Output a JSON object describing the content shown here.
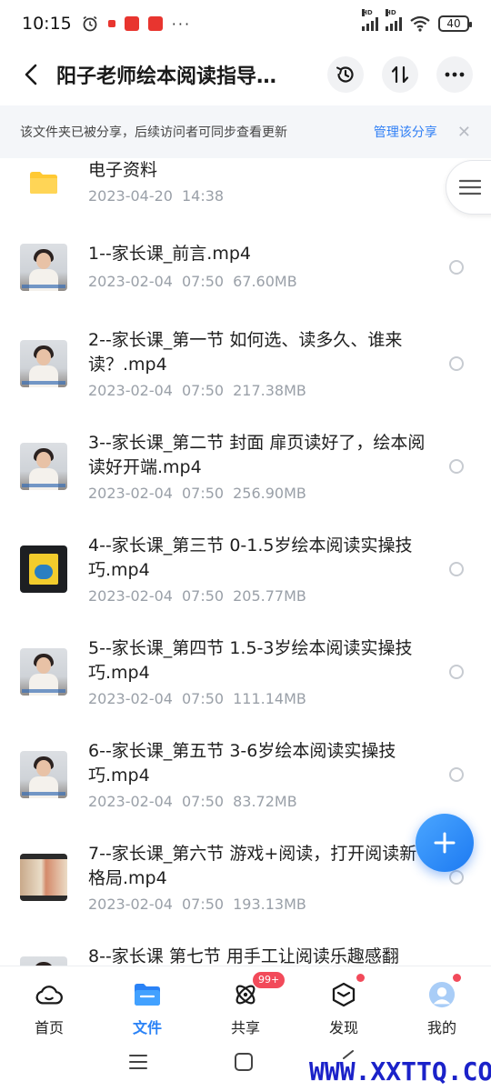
{
  "status_bar": {
    "time": "10:15",
    "battery": "40",
    "signal_label": "HD",
    "more": "···"
  },
  "header": {
    "title": "阳子老师绘本阅读指导…"
  },
  "share_banner": {
    "text": "该文件夹已被分享，后续访问者可同步查看更新",
    "manage_label": "管理该分享",
    "close": "✕"
  },
  "files": [
    {
      "name": "电子资料",
      "date": "2023-04-20",
      "time": "14:38",
      "size": "",
      "kind": "folder"
    },
    {
      "name": "1--家长课_前言.mp4",
      "date": "2023-02-04",
      "time": "07:50",
      "size": "67.60MB",
      "kind": "video-person"
    },
    {
      "name": "2--家长课_第一节 如何选、读多久、谁来读？.mp4",
      "date": "2023-02-04",
      "time": "07:50",
      "size": "217.38MB",
      "kind": "video-person"
    },
    {
      "name": "3--家长课_第二节 封面 扉页读好了，绘本阅读好开端.mp4",
      "date": "2023-02-04",
      "time": "07:50",
      "size": "256.90MB",
      "kind": "video-person"
    },
    {
      "name": "4--家长课_第三节 0-1.5岁绘本阅读实操技巧.mp4",
      "date": "2023-02-04",
      "time": "07:50",
      "size": "205.77MB",
      "kind": "video-book"
    },
    {
      "name": "5--家长课_第四节 1.5-3岁绘本阅读实操技巧.mp4",
      "date": "2023-02-04",
      "time": "07:50",
      "size": "111.14MB",
      "kind": "video-person"
    },
    {
      "name": "6--家长课_第五节 3-6岁绘本阅读实操技巧.mp4",
      "date": "2023-02-04",
      "time": "07:50",
      "size": "83.72MB",
      "kind": "video-person"
    },
    {
      "name": "7--家长课_第六节 游戏+阅读，打开阅读新格局.mp4",
      "date": "2023-02-04",
      "time": "07:50",
      "size": "193.13MB",
      "kind": "video-art"
    },
    {
      "name": "8--家长课 第七节 用手工让阅读乐趣感翻",
      "date": "",
      "time": "",
      "size": "",
      "kind": "video-person"
    }
  ],
  "bottom_nav": [
    {
      "label": "首页",
      "icon": "cloud-home-icon",
      "active": false
    },
    {
      "label": "文件",
      "icon": "folder-icon",
      "active": true
    },
    {
      "label": "共享",
      "icon": "atom-share-icon",
      "active": false,
      "badge": "99+"
    },
    {
      "label": "发现",
      "icon": "cube-discover-icon",
      "active": false,
      "dot": true
    },
    {
      "label": "我的",
      "icon": "avatar-icon",
      "active": false,
      "dot": true
    }
  ],
  "watermark": "WWW.XXTTQ.COM",
  "colors": {
    "accent": "#2a82f6",
    "link": "#2f7ff5",
    "badge": "#f24a5a",
    "folder": "#ffc933"
  }
}
